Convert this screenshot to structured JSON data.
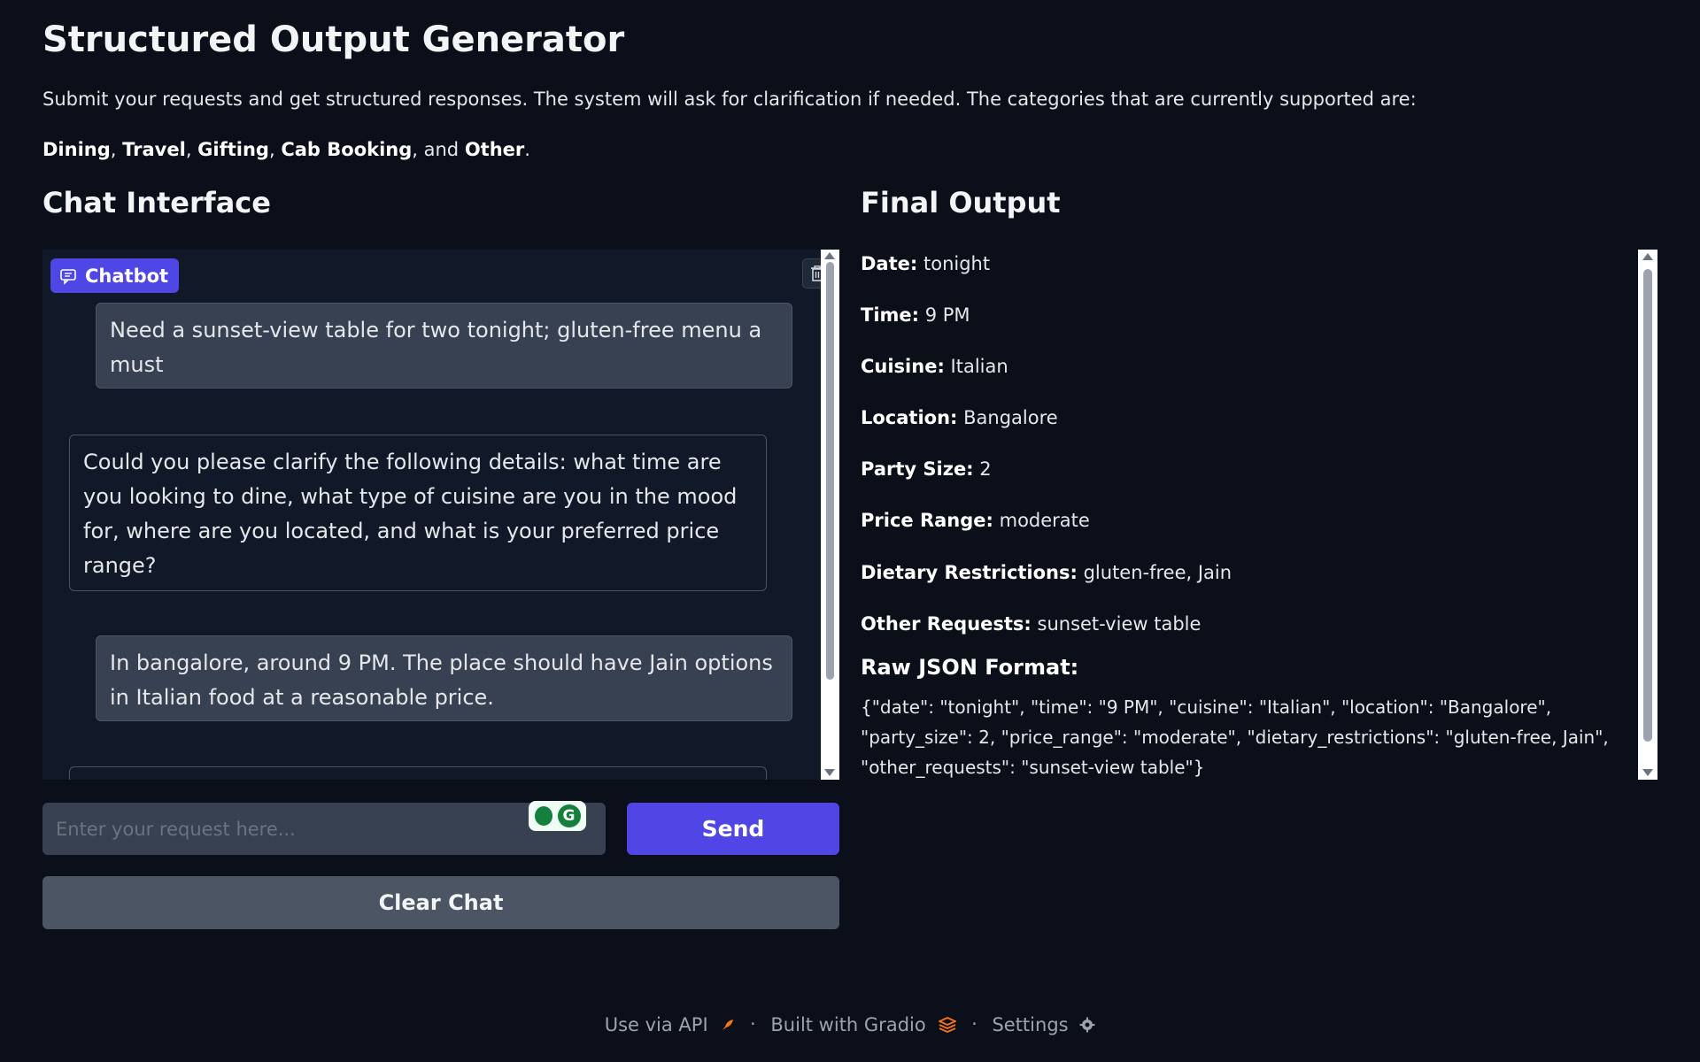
{
  "page": {
    "title": "Structured Output Generator",
    "intro": "Submit your requests and get structured responses. The system will ask for clarification if needed. The categories that are currently supported are:",
    "categories": [
      "Dining",
      "Travel",
      "Gifting",
      "Cab Booking",
      "Other"
    ],
    "categories_joiner": ", and ",
    "categories_end": "."
  },
  "chat": {
    "heading": "Chat Interface",
    "badge_label": "Chatbot",
    "messages": [
      {
        "role": "user",
        "text": "Need a sunset-view table for two tonight; gluten-free menu a must"
      },
      {
        "role": "bot",
        "text": "Could you please clarify the following details: what time are you looking to dine, what type of cuisine are you in the mood for, where are you located, and what is your preferred price range?"
      },
      {
        "role": "user",
        "text": "In bangalore, around 9 PM. The place should have Jain options in Italian food at a reasonable price."
      },
      {
        "role": "bot",
        "text": ""
      }
    ],
    "input_placeholder": "Enter your request here...",
    "send_label": "Send",
    "clear_label": "Clear Chat"
  },
  "output": {
    "heading": "Final Output",
    "fields": [
      {
        "label": "Date:",
        "value": "tonight"
      },
      {
        "label": "Time:",
        "value": "9 PM"
      },
      {
        "label": "Cuisine:",
        "value": "Italian"
      },
      {
        "label": "Location:",
        "value": "Bangalore"
      },
      {
        "label": "Party Size:",
        "value": "2"
      },
      {
        "label": "Price Range:",
        "value": "moderate"
      },
      {
        "label": "Dietary Restrictions:",
        "value": "gluten-free, Jain"
      },
      {
        "label": "Other Requests:",
        "value": "sunset-view table"
      }
    ],
    "raw_title": "Raw JSON Format:",
    "raw_json": "{\"date\": \"tonight\", \"time\": \"9 PM\", \"cuisine\": \"Italian\", \"location\": \"Bangalore\", \"party_size\": 2, \"price_range\": \"moderate\", \"dietary_restrictions\": \"gluten-free, Jain\", \"other_requests\": \"sunset-view table\"}"
  },
  "footer": {
    "api_label": "Use via API",
    "built_label": "Built with Gradio",
    "settings_label": "Settings",
    "separator": "·"
  },
  "colors": {
    "background": "#0b0f19",
    "accent": "#4f46e5",
    "panel": "#111827",
    "user_bubble": "#374151"
  },
  "icons": [
    "chat-bubble-icon",
    "trash-icon",
    "lightbulb-icon",
    "grammarly-icon",
    "rocket-icon",
    "gradio-logo-icon",
    "gear-icon"
  ]
}
